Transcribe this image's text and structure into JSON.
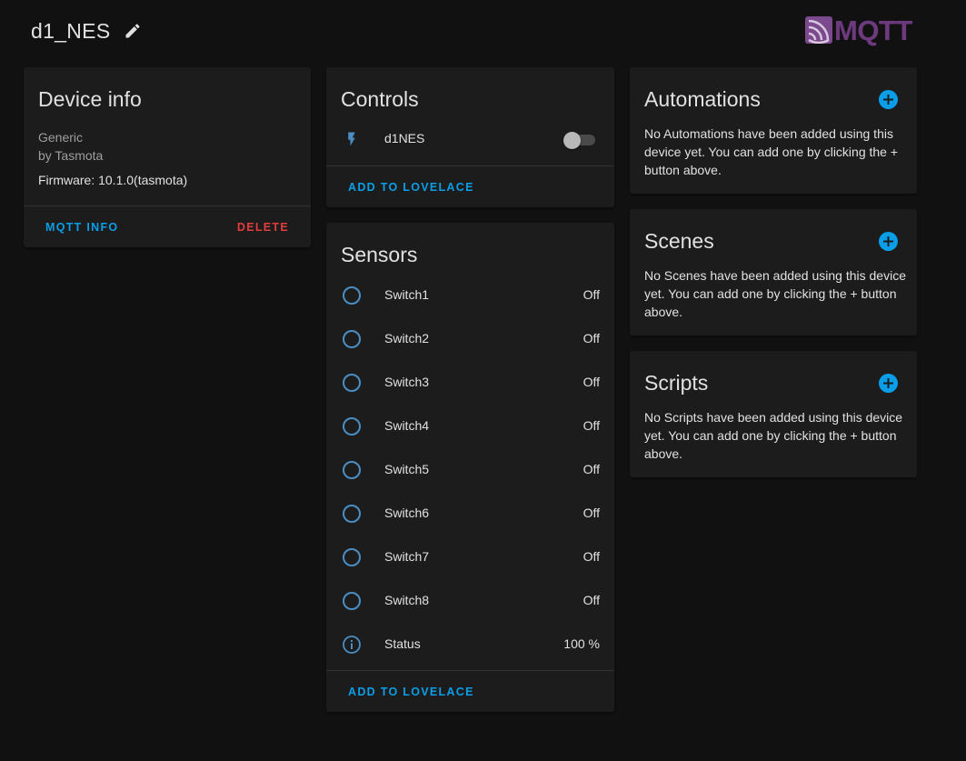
{
  "header": {
    "title": "d1_NES",
    "edit_icon": "pencil-icon"
  },
  "logo": {
    "text": "MQTT",
    "color": "#6c3a7d"
  },
  "device_info": {
    "title": "Device info",
    "model": "Generic",
    "manufacturer": "by Tasmota",
    "firmware": "Firmware: 10.1.0(tasmota)",
    "mqtt_info_label": "MQTT INFO",
    "delete_label": "DELETE"
  },
  "controls": {
    "title": "Controls",
    "items": [
      {
        "icon": "flash-icon",
        "label": "d1NES",
        "state": "off"
      }
    ],
    "add_label": "ADD TO LOVELACE"
  },
  "sensors": {
    "title": "Sensors",
    "items": [
      {
        "icon": "circle-outline-icon",
        "name": "Switch1",
        "state": "Off"
      },
      {
        "icon": "circle-outline-icon",
        "name": "Switch2",
        "state": "Off"
      },
      {
        "icon": "circle-outline-icon",
        "name": "Switch3",
        "state": "Off"
      },
      {
        "icon": "circle-outline-icon",
        "name": "Switch4",
        "state": "Off"
      },
      {
        "icon": "circle-outline-icon",
        "name": "Switch5",
        "state": "Off"
      },
      {
        "icon": "circle-outline-icon",
        "name": "Switch6",
        "state": "Off"
      },
      {
        "icon": "circle-outline-icon",
        "name": "Switch7",
        "state": "Off"
      },
      {
        "icon": "circle-outline-icon",
        "name": "Switch8",
        "state": "Off"
      },
      {
        "icon": "information-outline-icon",
        "name": "Status",
        "state": "100 %"
      }
    ],
    "add_label": "ADD TO LOVELACE"
  },
  "automations": {
    "title": "Automations",
    "text": "No Automations have been added using this device yet. You can add one by clicking the + button above."
  },
  "scenes": {
    "title": "Scenes",
    "text": "No Scenes have been added using this device yet. You can add one by clicking the + button above."
  },
  "scripts": {
    "title": "Scripts",
    "text": "No Scripts have been added using this device yet. You can add one by clicking the + button above."
  },
  "colors": {
    "background": "#111111",
    "card": "#1c1c1c",
    "primary": "#0a9ee8",
    "error": "#e23d3d",
    "icon": "#4a8ec4"
  }
}
